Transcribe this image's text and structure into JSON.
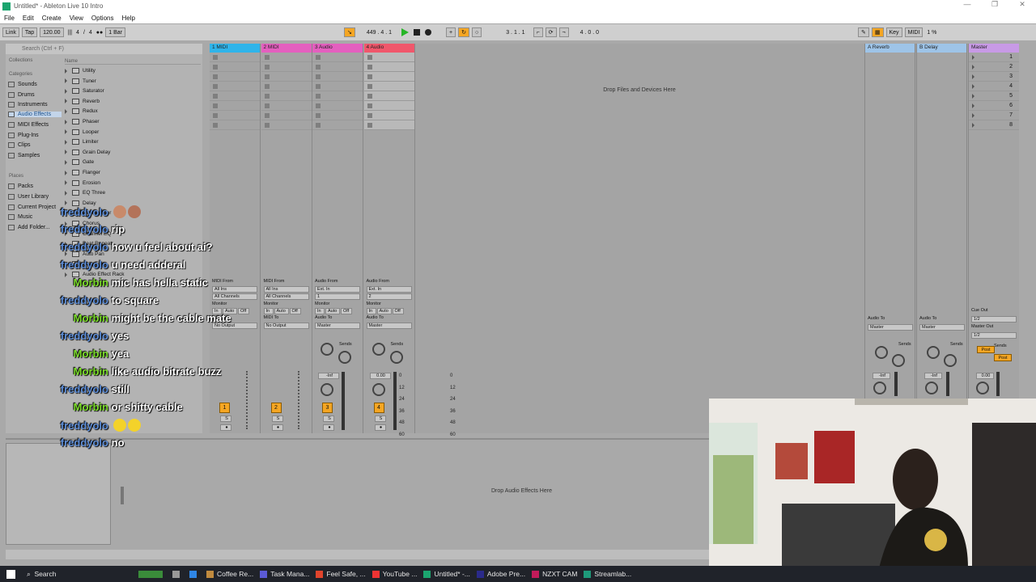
{
  "window": {
    "title": "Untitled* - Ableton Live 10 Intro",
    "controls": [
      "—",
      "❐",
      "✕"
    ]
  },
  "menu": [
    "File",
    "Edit",
    "Create",
    "View",
    "Options",
    "Help"
  ],
  "transport": {
    "link": "Link",
    "tap": "Tap",
    "tempo": "120.00",
    "signature_num": "4",
    "signature_den": "4",
    "quantize": "1 Bar",
    "position": "449 .   4 .   1",
    "loop_start": "3 .   1 .   1",
    "loop_length": "4 .   0 .   0",
    "key": "Key",
    "midi": "MIDI",
    "cpu": "1 %"
  },
  "browser": {
    "search_placeholder": "Search (Ctrl + F)",
    "collections": "Collections",
    "categories_header": "Categories",
    "categories": [
      "Sounds",
      "Drums",
      "Instruments",
      "Audio Effects",
      "MIDI Effects",
      "Plug-Ins",
      "Clips",
      "Samples"
    ],
    "selected_category": "Audio Effects",
    "places_header": "Places",
    "places": [
      "Packs",
      "User Library",
      "Current Project",
      "Music",
      "Add Folder..."
    ],
    "name_header": "Name",
    "items": [
      "Utility",
      "Tuner",
      "Saturator",
      "Reverb",
      "Redux",
      "Phaser",
      "Looper",
      "Limiter",
      "Grain Delay",
      "Gate",
      "Flanger",
      "Erosion",
      "EQ Three",
      "Delay",
      "Compressor",
      "Chorus",
      "Channel EQ",
      "Beat Repeat",
      "Auto Pan",
      "Auto Filter",
      "Audio Effect Rack"
    ]
  },
  "tracks": [
    {
      "name": "1 MIDI",
      "color": "#2fb4ea",
      "from_label": "MIDI From",
      "from": "All Ins",
      "channel": "All Channels",
      "to_label": "MIDI To",
      "to": "No Output",
      "number": "1"
    },
    {
      "name": "2 MIDI",
      "color": "#e45fbf",
      "from_label": "MIDI From",
      "from": "All Ins",
      "channel": "All Channels",
      "to_label": "MIDI To",
      "to": "No Output",
      "number": "2"
    },
    {
      "name": "3 Audio",
      "color": "#e45fbf",
      "from_label": "Audio From",
      "from": "Ext. In",
      "channel": "1",
      "to_label": "Audio To",
      "to": "Master",
      "number": "3",
      "vol": "-Inf"
    },
    {
      "name": "4 Audio",
      "color": "#f0576b",
      "from_label": "Audio From",
      "from": "Ext. In",
      "channel": "2",
      "to_label": "Audio To",
      "to": "Master",
      "number": "4",
      "vol": "0.00"
    }
  ],
  "monitor": {
    "label": "Monitor",
    "in": "In",
    "auto": "Auto",
    "off": "Off"
  },
  "sends_label": "Sends",
  "drop_files": "Drop Files and Devices Here",
  "returns": [
    {
      "name": "A Reverb",
      "color": "#9ec4e8",
      "to_label": "Audio To",
      "to": "Master",
      "vol": "-Inf"
    },
    {
      "name": "B Delay",
      "color": "#9ec4e8",
      "to_label": "Audio To",
      "to": "Master",
      "vol": "-Inf"
    }
  ],
  "master": {
    "name": "Master",
    "color": "#c89ae6",
    "cue_label": "Cue Out",
    "cue": "1/2",
    "out_label": "Master Out",
    "out": "1/2",
    "post": "Post",
    "vol": "0.00",
    "scenes": [
      "1",
      "2",
      "3",
      "4",
      "5",
      "6",
      "7",
      "8"
    ]
  },
  "meter_scale": [
    "0",
    "12",
    "24",
    "36",
    "48",
    "60"
  ],
  "drop_effects": "Drop Audio Effects Here",
  "chat": [
    {
      "user": "freddyolo",
      "msg": "",
      "emote": "faces"
    },
    {
      "user": "freddyolo",
      "msg": "rip"
    },
    {
      "user": "freddyolo",
      "msg": "how u feel about ai?"
    },
    {
      "user": "freddyolo",
      "msg": "u need adderal"
    },
    {
      "user": "Morbin",
      "msg": "mic has hella static"
    },
    {
      "user": "freddyolo",
      "msg": "to square"
    },
    {
      "user": "Morbin",
      "msg": "might be the cable mate"
    },
    {
      "user": "freddyolo",
      "msg": "yes"
    },
    {
      "user": "Morbin",
      "msg": "yea"
    },
    {
      "user": "Morbin",
      "msg": "like audio bitrate buzz"
    },
    {
      "user": "freddyolo",
      "msg": "still"
    },
    {
      "user": "Morbin",
      "msg": "or shitty cable"
    },
    {
      "user": "freddyolo",
      "msg": "",
      "emote": "chicks"
    },
    {
      "user": "freddyolo",
      "msg": "no"
    }
  ],
  "taskbar": {
    "search": "Search",
    "apps": [
      "Coffee Re...",
      "Task Mana...",
      "Feel Safe, ...",
      "YouTube ...",
      "Untitled* -...",
      "Adobe Pre...",
      "NZXT CAM",
      "Streamlab..."
    ]
  }
}
